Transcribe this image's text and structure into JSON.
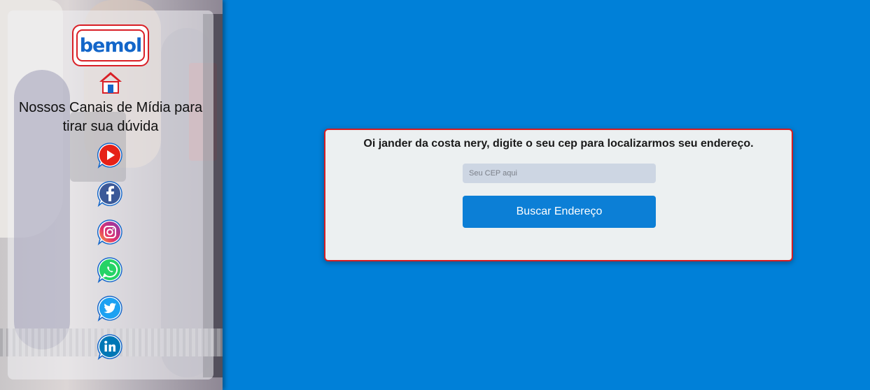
{
  "brand": {
    "logo_text": "bemol",
    "primary_color": "#1366c9",
    "accent_color": "#d91f26"
  },
  "sidebar": {
    "title": "Nossos Canais de Mídia para tirar sua dúvida",
    "home_icon": "home-icon",
    "social_links": [
      {
        "name": "youtube",
        "icon": "youtube-icon",
        "color": "#e62117"
      },
      {
        "name": "facebook",
        "icon": "facebook-icon",
        "color": "#3b5998"
      },
      {
        "name": "instagram",
        "icon": "instagram-icon",
        "color": "#c13584"
      },
      {
        "name": "whatsapp",
        "icon": "whatsapp-icon",
        "color": "#25d366"
      },
      {
        "name": "twitter",
        "icon": "twitter-icon",
        "color": "#1da1f2"
      },
      {
        "name": "linkedin",
        "icon": "linkedin-icon",
        "color": "#0077b5"
      }
    ]
  },
  "main": {
    "background_color": "#0080d8",
    "card": {
      "message": "Oi jander da costa nery, digite o seu cep para localizarmos seu endereço.",
      "cep_placeholder": "Seu CEP aqui",
      "cep_value": "",
      "button_label": "Buscar Endereço",
      "border_color": "#d61f24",
      "button_color": "#0c7fd6"
    }
  }
}
